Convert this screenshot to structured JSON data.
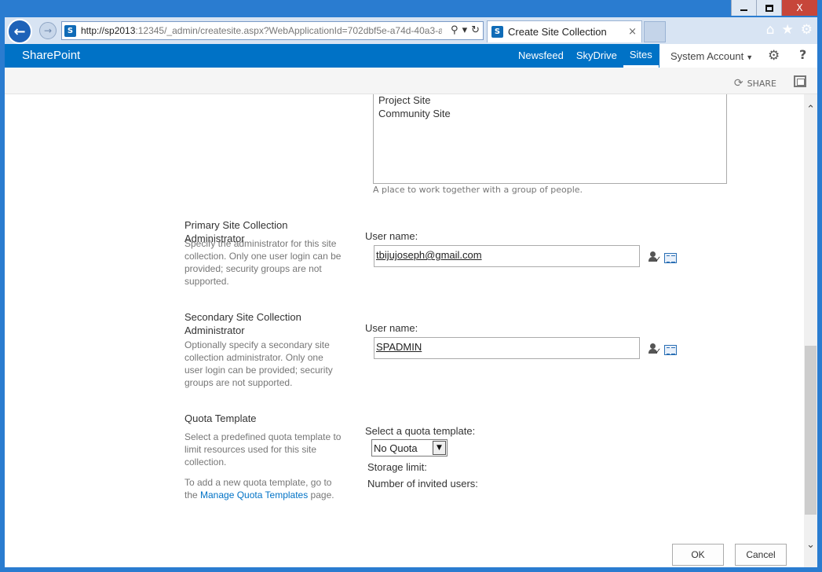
{
  "window": {
    "minimize_icon": "minimize-icon",
    "maximize_icon": "maximize-icon",
    "close_glyph": "X"
  },
  "browser": {
    "address_host": "http://sp2013",
    "address_rest": ":12345/_admin/createsite.aspx?WebApplicationId=702dbf5e-a74d-40a3-a",
    "tab_title": "Create Site Collection",
    "tab_close": "×"
  },
  "suitebar": {
    "brand": "SharePoint",
    "links": [
      "Newsfeed",
      "SkyDrive",
      "Sites"
    ],
    "active_link": "Sites",
    "account": "System Account"
  },
  "ribbon": {
    "share_label": "SHARE"
  },
  "template_section": {
    "items": [
      "Project Site",
      "Community Site"
    ],
    "description": "A place to work together with a group of people."
  },
  "primary_admin": {
    "title": "Primary Site Collection Administrator",
    "description": "Specify the administrator for this site collection. Only one user login can be provided; security groups are not supported.",
    "field_label": "User name:",
    "value": "tbijujoseph@gmail.com"
  },
  "secondary_admin": {
    "title": "Secondary Site Collection Administrator",
    "description": "Optionally specify a secondary site collection administrator. Only one user login can be provided; security groups are not supported.",
    "field_label": "User name:",
    "value": "SPADMIN"
  },
  "quota": {
    "title": "Quota Template",
    "description": "Select a predefined quota template to limit resources used for this site collection.",
    "add_text_before": "To add a new quota template, go to the ",
    "add_link": "Manage Quota Templates",
    "add_text_after": " page.",
    "select_label": "Select a quota template:",
    "selected": "No Quota",
    "storage_limit_label": "Storage limit:",
    "invited_users_label": "Number of invited users:"
  },
  "buttons": {
    "ok": "OK",
    "cancel": "Cancel"
  }
}
